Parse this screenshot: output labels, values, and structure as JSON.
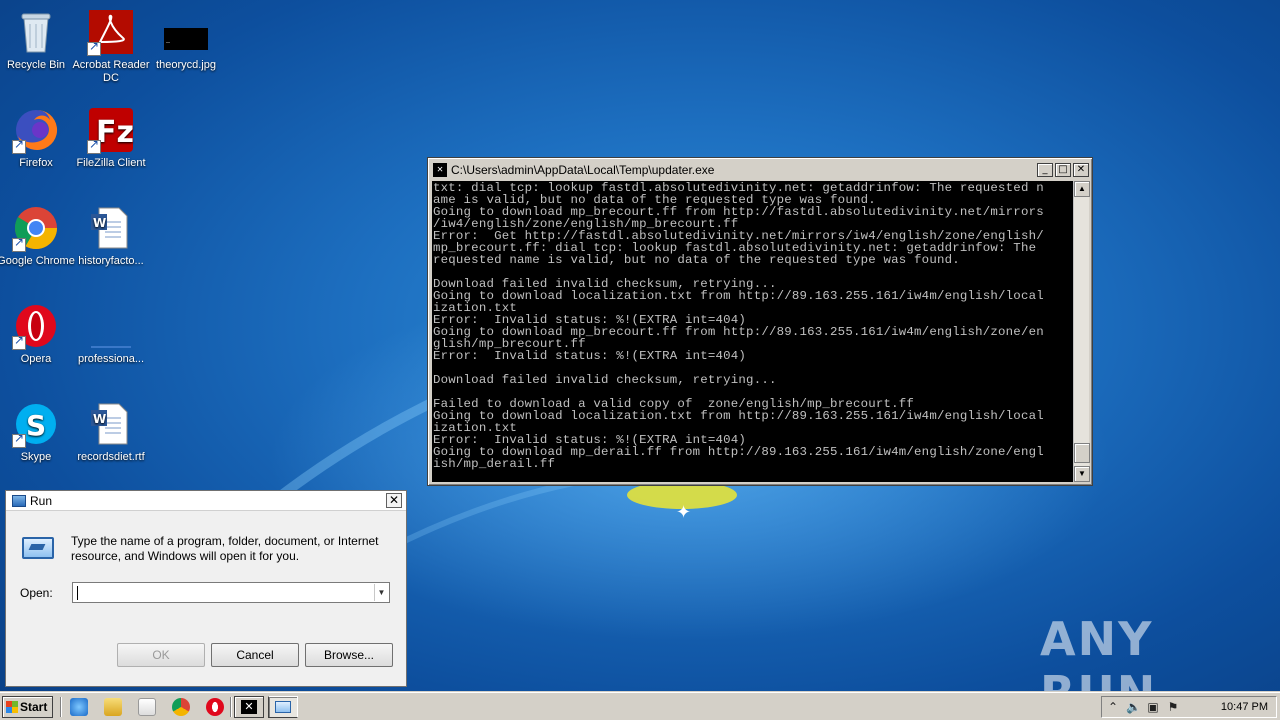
{
  "desktop": {
    "icons": [
      {
        "label": "Recycle Bin"
      },
      {
        "label": "Acrobat Reader DC"
      },
      {
        "label": "theorycd.jpg"
      },
      {
        "label": "Firefox"
      },
      {
        "label": "FileZilla Client"
      },
      {
        "label": "Google Chrome"
      },
      {
        "label": "historyfacto..."
      },
      {
        "label": "Opera"
      },
      {
        "label": "professiona..."
      },
      {
        "label": "Skype"
      },
      {
        "label": "recordsdiet.rtf"
      }
    ]
  },
  "console": {
    "title": "C:\\Users\\admin\\AppData\\Local\\Temp\\updater.exe",
    "lines": [
      "txt: dial tcp: lookup fastdl.absolutedivinity.net: getaddrinfow: The requested n",
      "ame is valid, but no data of the requested type was found.",
      "Going to download mp_brecourt.ff from http://fastdl.absolutedivinity.net/mirrors",
      "/iw4/english/zone/english/mp_brecourt.ff",
      "Error:  Get http://fastdl.absolutedivinity.net/mirrors/iw4/english/zone/english/",
      "mp_brecourt.ff: dial tcp: lookup fastdl.absolutedivinity.net: getaddrinfow: The",
      "requested name is valid, but no data of the requested type was found.",
      "",
      "Download failed invalid checksum, retrying...",
      "Going to download localization.txt from http://89.163.255.161/iw4m/english/local",
      "ization.txt",
      "Error:  Invalid status: %!(EXTRA int=404)",
      "Going to download mp_brecourt.ff from http://89.163.255.161/iw4m/english/zone/en",
      "glish/mp_brecourt.ff",
      "Error:  Invalid status: %!(EXTRA int=404)",
      "",
      "Download failed invalid checksum, retrying...",
      "",
      "Failed to download a valid copy of  zone/english/mp_brecourt.ff",
      "Going to download localization.txt from http://89.163.255.161/iw4m/english/local",
      "ization.txt",
      "Error:  Invalid status: %!(EXTRA int=404)",
      "Going to download mp_derail.ff from http://89.163.255.161/iw4m/english/zone/engl",
      "ish/mp_derail.ff"
    ]
  },
  "run_dialog": {
    "title": "Run",
    "description": "Type the name of a program, folder, document, or Internet resource, and Windows will open it for you.",
    "open_label": "Open:",
    "open_value": "",
    "ok_label": "OK",
    "cancel_label": "Cancel",
    "browse_label": "Browse..."
  },
  "taskbar": {
    "start_label": "Start",
    "clock": "10:47 PM"
  },
  "watermark": "ANY RUN"
}
